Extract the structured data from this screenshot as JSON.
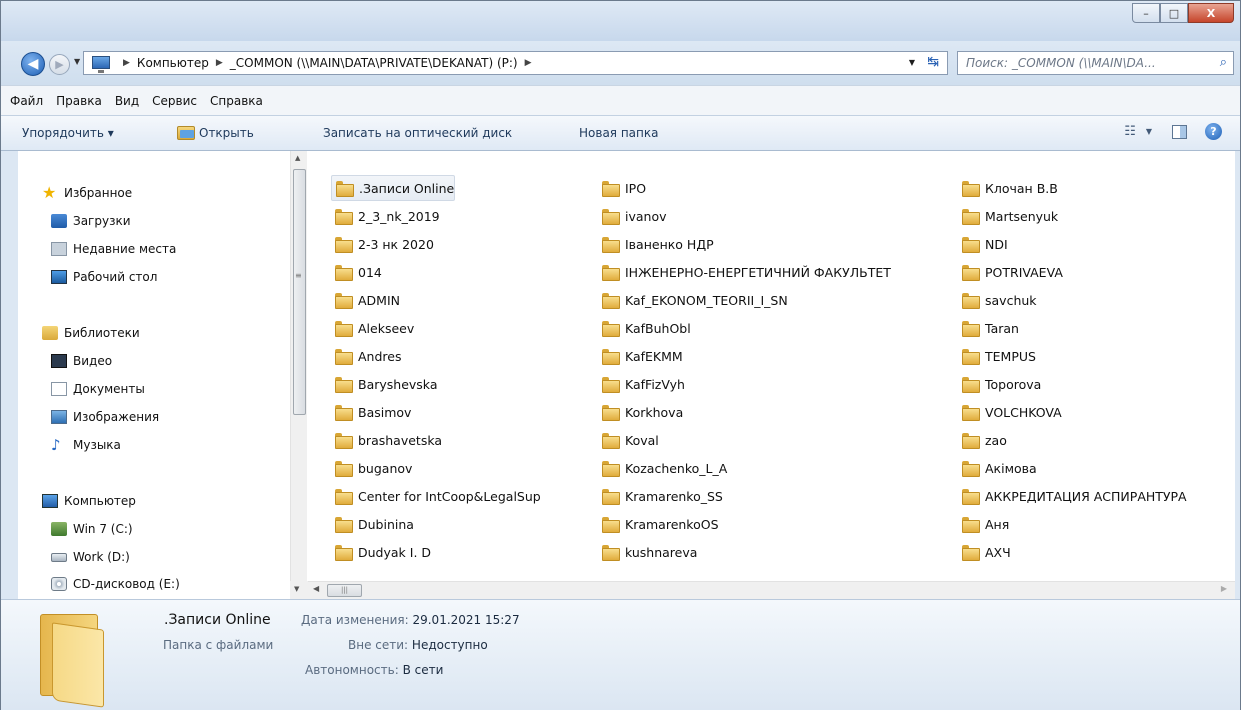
{
  "window": {
    "buttons": {
      "minimize": "–",
      "maximize": "□",
      "close": "X"
    }
  },
  "address": {
    "crumbs": [
      "Компьютер",
      "_COMMON (\\\\MAIN\\DATA\\PRIVATE\\DEKANAT) (P:)"
    ],
    "search_placeholder": "Поиск: _COMMON (\\\\MAIN\\DA..."
  },
  "menu": [
    "Файл",
    "Правка",
    "Вид",
    "Сервис",
    "Справка"
  ],
  "toolbar": {
    "organize": "Упорядочить ▾",
    "open": "Открыть",
    "burn": "Записать на оптический диск",
    "new_folder": "Новая папка"
  },
  "nav": {
    "favorites": "Избранное",
    "downloads": "Загрузки",
    "recent": "Недавние места",
    "desktop": "Рабочий стол",
    "libraries": "Библиотеки",
    "video": "Видео",
    "documents": "Документы",
    "images": "Изображения",
    "music": "Музыка",
    "computer": "Компьютер",
    "drive_c": "Win 7 (C:)",
    "drive_d": "Work (D:)",
    "drive_e": "CD-дисковод (E:)"
  },
  "files": {
    "col1": [
      ".Записи Online",
      "2_3_nk_2019",
      "2-3 нк 2020",
      "014",
      "ADMIN",
      "Alekseev",
      "Andres",
      "Baryshevska",
      "Basimov",
      "brashavetska",
      "buganov",
      "Center for IntCoop&LegalSup",
      "Dubinina",
      "Dudyak I. D"
    ],
    "col2": [
      "IPO",
      "ivanov",
      "Іваненко НДР",
      "ІНЖЕНЕРНО-ЕНЕРГЕТИЧНИЙ ФАКУЛЬТЕТ",
      "Kaf_EKONOM_TEORII_I_SN",
      "KafBuhObl",
      "KafEKMM",
      "KafFizVyh",
      "Korkhova",
      "Koval",
      "Kozachenko_L_A",
      "Kramarenko_SS",
      "KramarenkoOS",
      "kushnareva"
    ],
    "col3": [
      "Клочан В.В",
      "Martsenyuk",
      "NDI",
      "POTRIVAEVA",
      "savchuk",
      "Taran",
      "TEMPUS",
      "Toporova",
      "VOLCHKOVA",
      "zao",
      "Акімова",
      "АККРЕДИТАЦИЯ АСПИРАНТУРА",
      "Аня",
      "АХЧ"
    ]
  },
  "details": {
    "name": ".Записи Online",
    "type": "Папка с файлами",
    "modified_label": "Дата изменения:",
    "modified_value": "29.01.2021 15:27",
    "offline_label": "Вне сети:",
    "offline_value": "Недоступно",
    "autonomy_label": "Автономность:",
    "autonomy_value": "В сети"
  }
}
